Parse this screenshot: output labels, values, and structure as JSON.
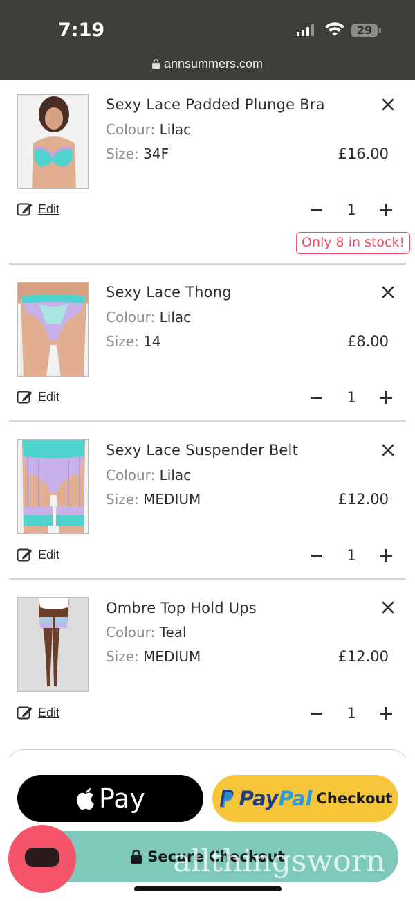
{
  "status_bar": {
    "time": "7:19",
    "battery": "29",
    "url": "annsummers.com"
  },
  "cart": {
    "edit_label": "Edit",
    "colour_label": "Colour:",
    "size_label": "Size:",
    "items": [
      {
        "name": "Sexy Lace Padded Plunge Bra",
        "colour": "Lilac",
        "size": "34F",
        "price": "£16.00",
        "quantity": "1",
        "stock_notice": "Only 8 in stock!"
      },
      {
        "name": "Sexy Lace Thong",
        "colour": "Lilac",
        "size": "14",
        "price": "£8.00",
        "quantity": "1"
      },
      {
        "name": "Sexy Lace Suspender Belt",
        "colour": "Lilac",
        "size": "MEDIUM",
        "price": "£12.00",
        "quantity": "1"
      },
      {
        "name": "Ombre Top Hold Ups",
        "colour": "Teal",
        "size": "MEDIUM",
        "price": "£12.00",
        "quantity": "1"
      }
    ]
  },
  "checkout": {
    "apple_pay_label": "Pay",
    "paypal_brand_1": "Pay",
    "paypal_brand_2": "Pal",
    "paypal_label": "Checkout",
    "secure_label": "Secure Checkout"
  },
  "watermark": "allthingsworn",
  "colors": {
    "accent_pink": "#ef4a65",
    "secure_green": "#7ec9bb",
    "paypal_yellow": "#f7c53a",
    "status_bar": "#3f3d37"
  }
}
